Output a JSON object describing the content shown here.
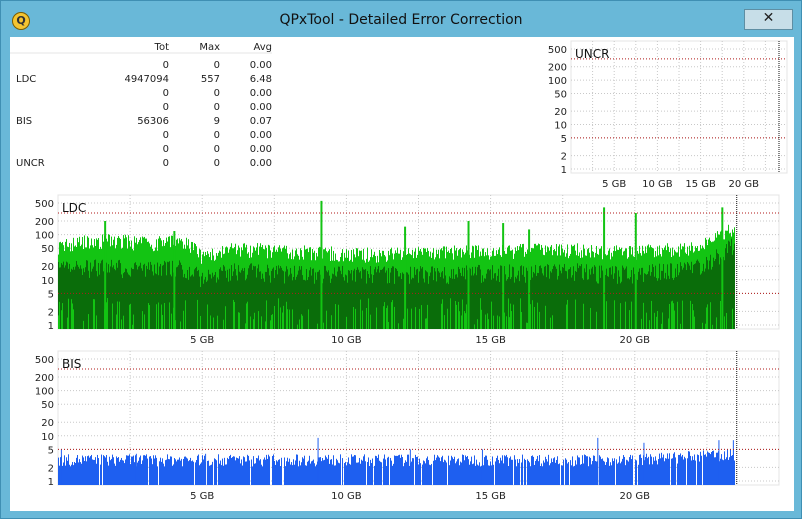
{
  "window": {
    "title": "QPxTool - Detailed Error Correction",
    "app_icon": "qpxtool-logo-icon",
    "close_glyph": "✕",
    "colors": {
      "frame": "#69b8d8",
      "title_text": "#111111"
    }
  },
  "stats": {
    "headers": [
      "Tot",
      "Max",
      "Avg"
    ],
    "rows": [
      {
        "label": "",
        "tot": "0",
        "max": "0",
        "avg": "0.00"
      },
      {
        "label": "LDC",
        "tot": "4947094",
        "max": "557",
        "avg": "6.48"
      },
      {
        "label": "",
        "tot": "0",
        "max": "0",
        "avg": "0.00"
      },
      {
        "label": "",
        "tot": "0",
        "max": "0",
        "avg": "0.00"
      },
      {
        "label": "BIS",
        "tot": "56306",
        "max": "9",
        "avg": "0.07"
      },
      {
        "label": "",
        "tot": "0",
        "max": "0",
        "avg": "0.00"
      },
      {
        "label": "",
        "tot": "0",
        "max": "0",
        "avg": "0.00"
      },
      {
        "label": "UNCR",
        "tot": "0",
        "max": "0",
        "avg": "0.00"
      }
    ]
  },
  "chart_data": [
    {
      "type": "bar",
      "title": "UNCR",
      "scale": "log",
      "ylim": [
        1,
        500
      ],
      "y_ticks": [
        "500",
        "200",
        "100",
        "50",
        "20",
        "10",
        "5",
        "2",
        "1"
      ],
      "x_ticks": [
        "5 GB",
        "10 GB",
        "15 GB",
        "20 GB"
      ],
      "xlim_gb": [
        0,
        25
      ],
      "threshold_lines": [
        300,
        5
      ],
      "series": [],
      "grid": true
    },
    {
      "type": "bar",
      "title": "LDC",
      "scale": "log",
      "ylim": [
        1,
        500
      ],
      "y_ticks": [
        "500",
        "200",
        "100",
        "50",
        "20",
        "10",
        "5",
        "2",
        "1"
      ],
      "x_ticks": [
        "5 GB",
        "10 GB",
        "15 GB",
        "20 GB"
      ],
      "xlim_gb": [
        0,
        25
      ],
      "data_end_gb": 23.5,
      "threshold_lines": [
        300,
        5
      ],
      "colors": {
        "upper": "#13c413",
        "lower": "#0a6d0a",
        "threshold": "#b01a1a"
      },
      "series": [
        {
          "role": "upper",
          "x_gb": [
            0.0,
            1.0,
            2.0,
            3.0,
            4.0,
            4.5,
            5.0,
            6.0,
            7.0,
            8.0,
            9.0,
            10.0,
            11.0,
            12.0,
            13.0,
            14.0,
            15.0,
            16.0,
            17.0,
            18.0,
            19.0,
            20.0,
            21.0,
            22.0,
            22.5,
            23.0,
            23.5
          ],
          "values": [
            60,
            75,
            80,
            70,
            75,
            70,
            35,
            50,
            50,
            45,
            45,
            40,
            40,
            40,
            42,
            45,
            45,
            48,
            50,
            50,
            45,
            45,
            50,
            55,
            70,
            110,
            150
          ]
        },
        {
          "role": "lower",
          "x_gb": [
            0.0,
            1.0,
            2.0,
            3.0,
            4.0,
            4.5,
            5.0,
            6.0,
            7.0,
            8.0,
            9.0,
            10.0,
            11.0,
            12.0,
            13.0,
            14.0,
            15.0,
            16.0,
            17.0,
            18.0,
            19.0,
            20.0,
            21.0,
            22.0,
            22.5,
            23.0,
            23.5
          ],
          "values": [
            20,
            22,
            22,
            20,
            22,
            20,
            12,
            18,
            18,
            16,
            16,
            16,
            16,
            15,
            16,
            16,
            17,
            17,
            18,
            18,
            16,
            16,
            18,
            20,
            25,
            45,
            70
          ]
        },
        {
          "role": "spikes",
          "x_gb": [
            1.6,
            4.0,
            9.1,
            12.0,
            14.2,
            15.4,
            16.3,
            18.9,
            20.0,
            23.0
          ],
          "values": [
            200,
            120,
            557,
            150,
            200,
            180,
            130,
            400,
            300,
            400
          ]
        }
      ],
      "grid": true
    },
    {
      "type": "bar",
      "title": "BIS",
      "scale": "log",
      "ylim": [
        1,
        500
      ],
      "y_ticks": [
        "500",
        "200",
        "100",
        "50",
        "20",
        "10",
        "5",
        "2",
        "1"
      ],
      "x_ticks": [
        "5 GB",
        "10 GB",
        "15 GB",
        "20 GB"
      ],
      "xlim_gb": [
        0,
        25
      ],
      "data_end_gb": 23.5,
      "threshold_lines": [
        300,
        5
      ],
      "colors": {
        "bars": "#1e5ff0",
        "threshold": "#b01a1a"
      },
      "series": [
        {
          "role": "base",
          "x_gb": [
            0.0,
            5.0,
            10.0,
            15.0,
            20.0,
            23.5
          ],
          "values": [
            3,
            3,
            3,
            3,
            3,
            4
          ]
        },
        {
          "role": "spikes",
          "x_gb": [
            0.1,
            2.7,
            5.1,
            9.0,
            12.2,
            14.7,
            18.7,
            20.3,
            22.9,
            23.4
          ],
          "values": [
            5,
            4,
            4,
            9,
            5,
            5,
            9,
            7,
            8,
            8
          ]
        }
      ],
      "grid": true
    }
  ]
}
